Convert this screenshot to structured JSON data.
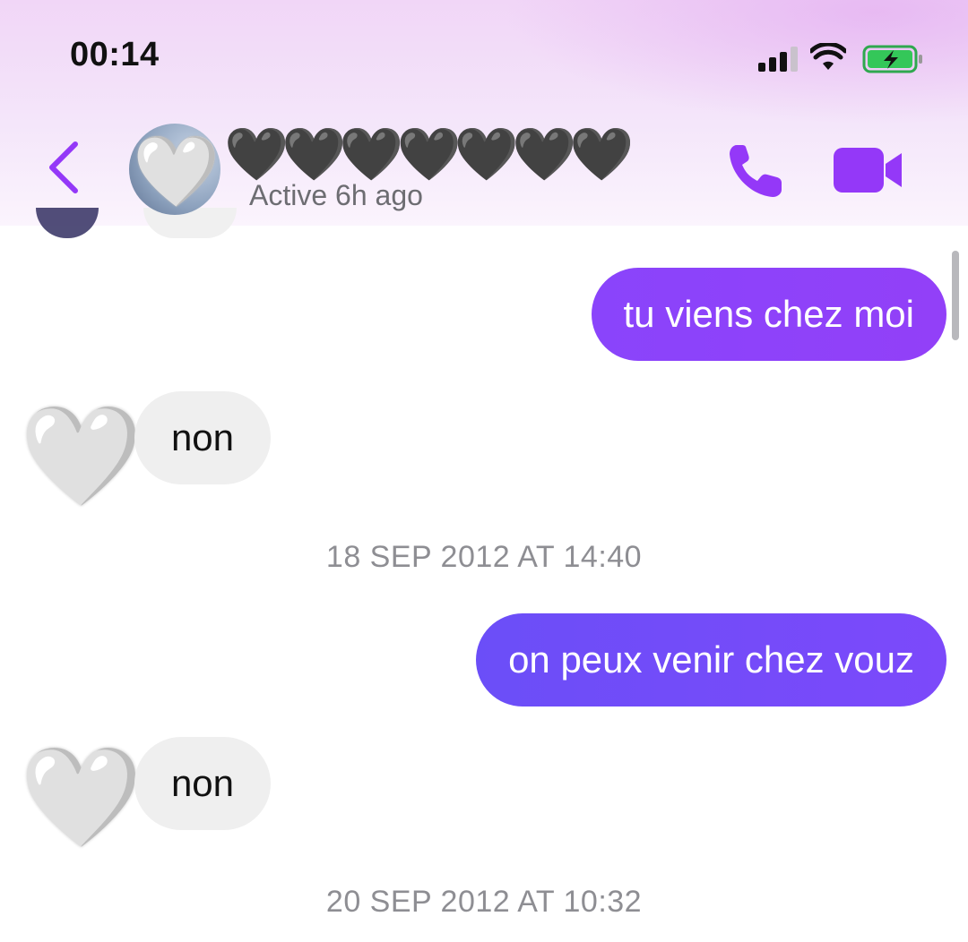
{
  "status_bar": {
    "time": "00:14",
    "icons": [
      "signal-icon",
      "wifi-icon",
      "battery-charging-icon"
    ]
  },
  "header": {
    "contact_name": "🖤🖤🖤🖤🖤🖤🖤",
    "active_status": "Active 6h ago",
    "avatar_emoji": "🤍",
    "icons": [
      "back-chevron-icon",
      "phone-icon",
      "video-camera-icon"
    ]
  },
  "messages": [
    {
      "kind": "outgoing",
      "text": "tu viens chez moi"
    },
    {
      "kind": "incoming",
      "text": "non",
      "avatar": "🤍"
    },
    {
      "kind": "timestamp",
      "text": "18 SEP 2012 AT 14:40"
    },
    {
      "kind": "outgoing",
      "text": "on peux venir chez vouz"
    },
    {
      "kind": "incoming",
      "text": "non",
      "avatar": "🤍"
    },
    {
      "kind": "timestamp",
      "text": "20 SEP 2012 AT 10:32"
    }
  ],
  "colors": {
    "accent": "#9438f8",
    "outgoing_bubble_1": "#8c42fb",
    "outgoing_bubble_2": "#734bf9",
    "incoming_bubble": "#efefef",
    "timestamp": "#8e8e93"
  }
}
